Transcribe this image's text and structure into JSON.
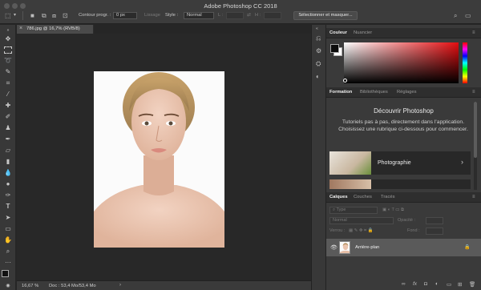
{
  "window": {
    "title": "Adobe Photoshop CC 2018"
  },
  "options_bar": {
    "feather_label": "Contour progr. :",
    "feather_value": "0 px",
    "smoothing_label": "Lissage",
    "style_label": "Style :",
    "style_value": "Normal",
    "width_label": "L :",
    "height_label": "H :",
    "select_mask_label": "Sélectionner et masquer..."
  },
  "document": {
    "tab_title": "786.jpg @ 16,7% (RVB/8)",
    "close_glyph": "×",
    "zoom": "16,67 %",
    "doc_info": "Doc : 53,4 Mo/53,4 Mo"
  },
  "color_panel": {
    "tabs": [
      "Couleur",
      "Nuancier"
    ],
    "foreground": "#0d0d0d",
    "background": "#ffffff",
    "hue_color": "#e40d10"
  },
  "learn_panel": {
    "tabs": [
      "Formation",
      "Bibliothèques",
      "Réglages"
    ],
    "title": "Découvrir Photoshop",
    "description": "Tutoriels pas à pas, directement dans l'application. Choisissez une rubrique ci-dessous pour commencer.",
    "card_label": "Photographie"
  },
  "layers_panel": {
    "tabs": [
      "Calques",
      "Couches",
      "Tracés"
    ],
    "filter_placeholder": "Type",
    "blend_mode": "Normal",
    "opacity_label": "Opacité :",
    "lock_label": "Verrou :",
    "fill_label": "Fond :",
    "layer_name": "Arrière-plan"
  },
  "icons": {
    "toolbar": [
      "move-icon",
      "marquee-icon",
      "lasso-icon",
      "quick-select-icon",
      "crop-icon",
      "eyedropper-icon",
      "healing-icon",
      "brush-icon",
      "stamp-icon",
      "history-brush-icon",
      "eraser-icon",
      "gradient-icon",
      "blur-icon",
      "dodge-icon",
      "pen-icon",
      "type-icon",
      "path-select-icon",
      "rectangle-icon",
      "hand-icon",
      "zoom-icon",
      "more-tools-icon"
    ]
  }
}
